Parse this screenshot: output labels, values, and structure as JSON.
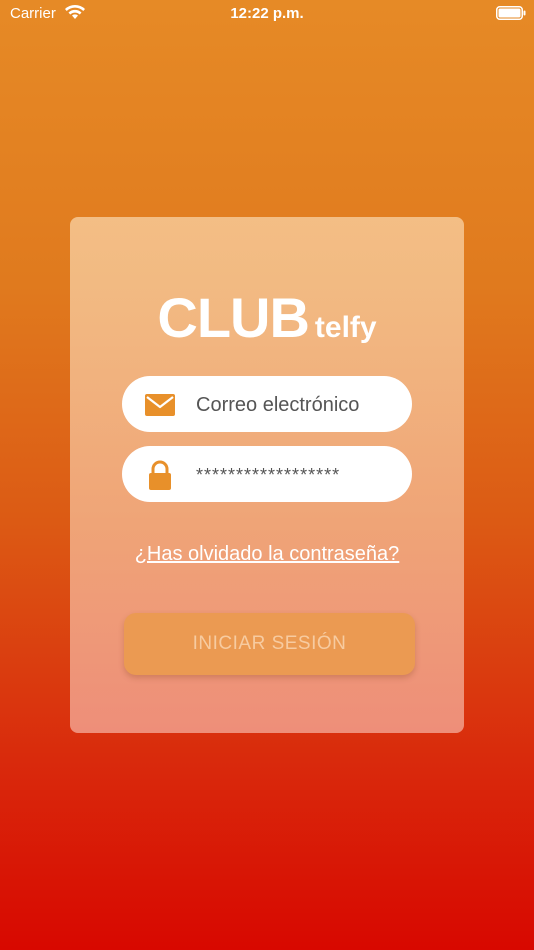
{
  "status_bar": {
    "carrier": "Carrier",
    "time": "12:22 p.m."
  },
  "logo": {
    "main": "CLUB",
    "sub": "telfy"
  },
  "email_field": {
    "placeholder": "Correo electrónico",
    "icon": "mail-icon"
  },
  "password_field": {
    "value": "******************",
    "icon": "lock-icon"
  },
  "forgot_password": "¿Has olvidado la contraseña?",
  "login_button": "INICIAR SESIÓN",
  "colors": {
    "accent": "#e8902a",
    "button_bg": "#eb9a52",
    "gradient_top": "#e68a26",
    "gradient_bottom": "#d80800"
  }
}
